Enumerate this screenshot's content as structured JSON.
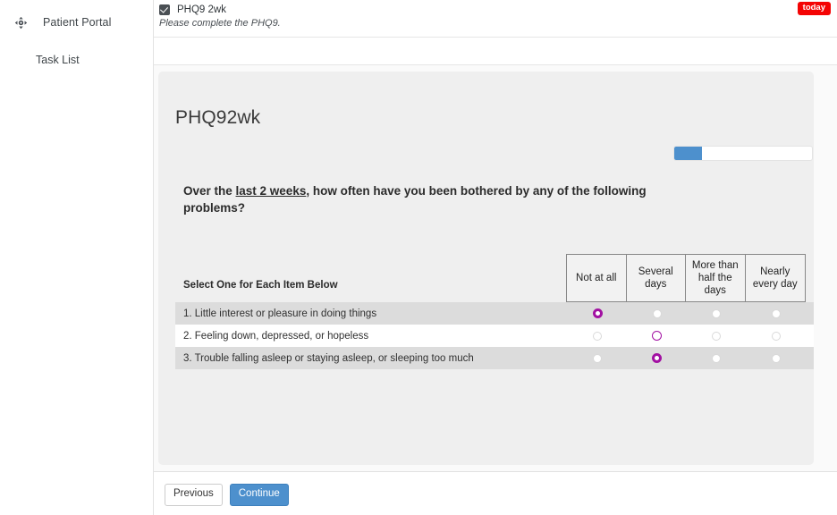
{
  "sidebar": {
    "brand": {
      "icon": "move-arrows-icon",
      "label": "Patient Portal"
    },
    "items": [
      {
        "label": "Task List"
      }
    ]
  },
  "task_header": {
    "checkbox_checked": true,
    "title": "PHQ9 2wk",
    "subtitle": "Please complete the PHQ9.",
    "badge": "today",
    "badge_color": "#f40404"
  },
  "survey": {
    "title": "PHQ92wk",
    "progress": {
      "percent": 20,
      "fill_color": "#4d90cd"
    },
    "prompt": {
      "before": "Over the ",
      "underlined": "last 2 weeks",
      "after": ", how often have you been bothered by any of the following problems?"
    },
    "instruction": "Select One for Each Item Below",
    "columns": [
      "Not at all",
      "Several days",
      "More than half the days",
      "Nearly every day"
    ],
    "items": [
      {
        "label": "1. Little interest or pleasure in doing things",
        "selected": 0
      },
      {
        "label": "2. Feeling down, depressed, or hopeless",
        "selected": 1
      },
      {
        "label": "3. Trouble falling asleep or staying asleep, or sleeping too much",
        "selected": 1
      }
    ],
    "selected_color": "#a211a2"
  },
  "footer": {
    "previous_label": "Previous",
    "continue_label": "Continue"
  }
}
